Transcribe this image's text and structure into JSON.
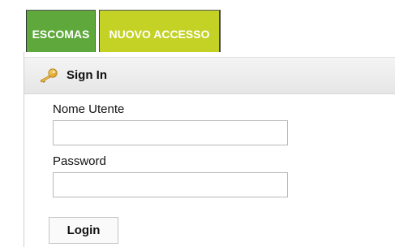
{
  "tabs": {
    "escomas": {
      "label": "ESCOMAS"
    },
    "nuovo_accesso": {
      "label": "NUOVO ACCESSO"
    }
  },
  "panel": {
    "icon": "key-icon",
    "title": "Sign In"
  },
  "form": {
    "username": {
      "label": "Nome Utente",
      "value": ""
    },
    "password": {
      "label": "Password",
      "value": ""
    },
    "login_label": "Login"
  },
  "colors": {
    "tab_escomas": "#5fa93c",
    "tab_nuovo_accesso": "#c3d224",
    "key": "#e8b23a"
  }
}
